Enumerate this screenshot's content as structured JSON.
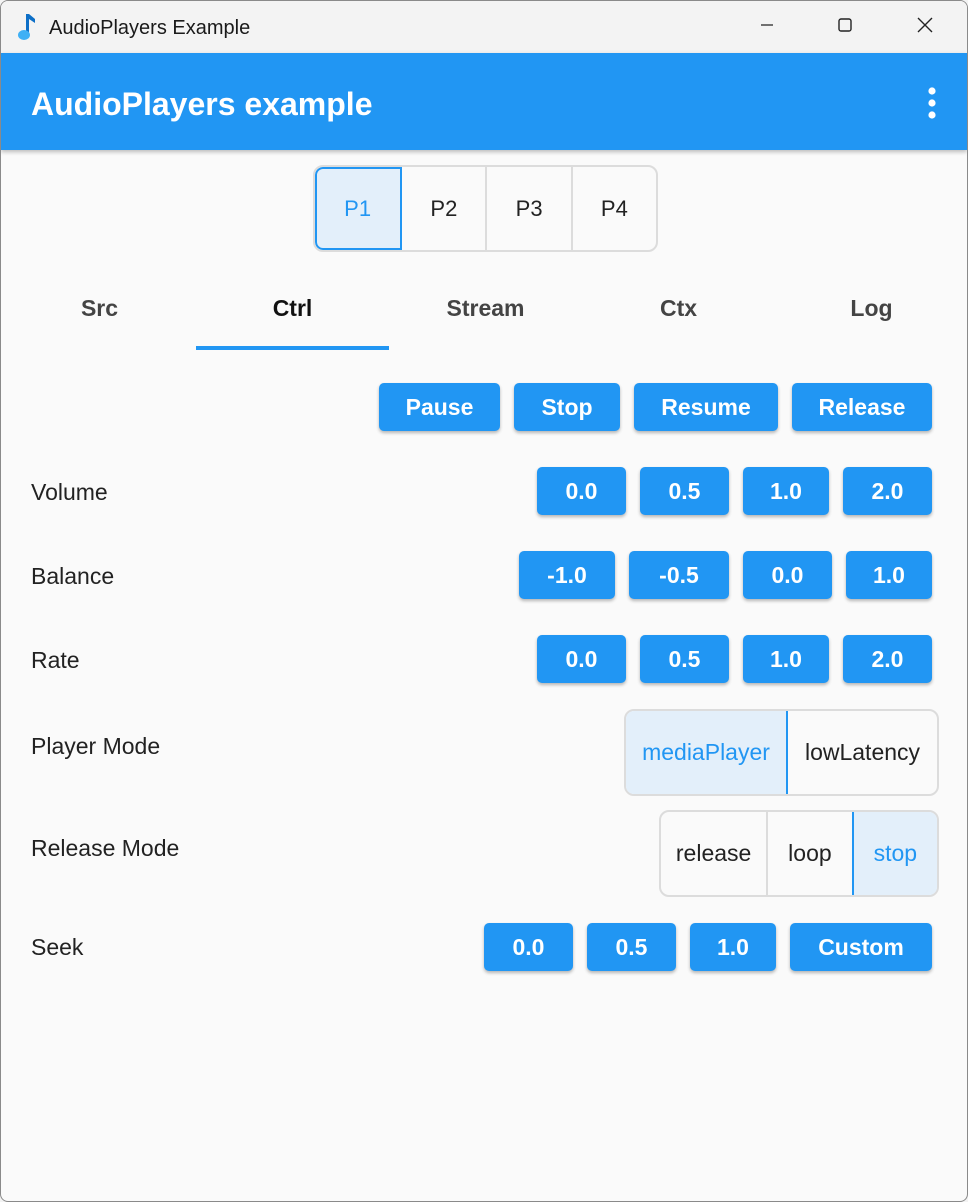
{
  "window": {
    "title": "AudioPlayers Example",
    "controls": {
      "minimize": "minimize-icon",
      "maximize": "maximize-icon",
      "close": "close-icon"
    }
  },
  "appbar": {
    "title": "AudioPlayers example",
    "menu_icon": "more-vert-icon"
  },
  "players": {
    "items": [
      "P1",
      "P2",
      "P3",
      "P4"
    ],
    "selected": "P1"
  },
  "tabs": {
    "items": [
      "Src",
      "Ctrl",
      "Stream",
      "Ctx",
      "Log"
    ],
    "selected": "Ctrl"
  },
  "controls": {
    "pause": "Pause",
    "stop": "Stop",
    "resume": "Resume",
    "release": "Release"
  },
  "volume": {
    "label": "Volume",
    "options": [
      "0.0",
      "0.5",
      "1.0",
      "2.0"
    ]
  },
  "balance": {
    "label": "Balance",
    "options": [
      "-1.0",
      "-0.5",
      "0.0",
      "1.0"
    ]
  },
  "rate": {
    "label": "Rate",
    "options": [
      "0.0",
      "0.5",
      "1.0",
      "2.0"
    ]
  },
  "player_mode": {
    "label": "Player Mode",
    "options": [
      "mediaPlayer",
      "lowLatency"
    ],
    "selected": "mediaPlayer"
  },
  "release_mode": {
    "label": "Release Mode",
    "options": [
      "release",
      "loop",
      "stop"
    ],
    "selected": "stop"
  },
  "seek": {
    "label": "Seek",
    "options": [
      "0.0",
      "0.5",
      "1.0",
      "Custom"
    ]
  },
  "colors": {
    "accent": "#2196f3",
    "selected_bg": "#e3effa",
    "background": "#fafafa"
  }
}
